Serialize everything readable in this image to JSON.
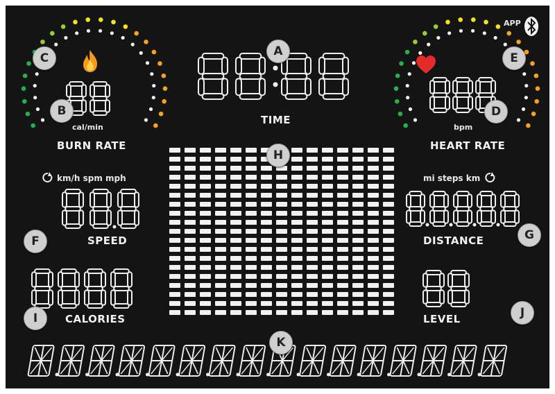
{
  "colors": {
    "background": "#141414",
    "segment": "#efefef",
    "marker_fill": "#cfcfcf",
    "flame": "#f59a1c",
    "heart": "#e52a2a",
    "scale_green": "#22b24c",
    "scale_lime": "#9acd32",
    "scale_yellow": "#f3e514",
    "scale_orange": "#f5a21c"
  },
  "display": {
    "time": {
      "label": "TIME",
      "digits": "88:88",
      "marker": "A"
    },
    "burn_rate": {
      "label": "BURN RATE",
      "unit": "cal/min",
      "digits": "88",
      "icon": "flame-icon",
      "marker_digits": "B",
      "marker_scale": "C"
    },
    "heart_rate": {
      "label": "HEART RATE",
      "unit": "bpm",
      "digits": "888",
      "icon": "heart-icon",
      "marker_digits": "D",
      "marker_icon": "E",
      "app_label": "APP",
      "app_icon": "bluetooth-icon"
    },
    "speed": {
      "label": "SPEED",
      "units": "km/h spm mph",
      "unit_icon": "cycle-arrows-icon",
      "digits": "88.8",
      "marker": "F"
    },
    "distance": {
      "label": "DISTANCE",
      "units": "mi steps km",
      "unit_icon": "cycle-arrows-icon",
      "digits": "8.8.8.8.8",
      "marker": "G"
    },
    "matrix": {
      "icon": "dot-matrix-grid",
      "marker": "H"
    },
    "calories": {
      "label": "CALORIES",
      "digits": "8888",
      "marker": "I"
    },
    "level": {
      "label": "LEVEL",
      "digits": "88",
      "marker": "J"
    },
    "message": {
      "digits": "8.8.8.8.8.8.8.8.8.8.8.8.8.8.8.8",
      "marker": "K",
      "icon": "sixteen-segment-row"
    }
  }
}
